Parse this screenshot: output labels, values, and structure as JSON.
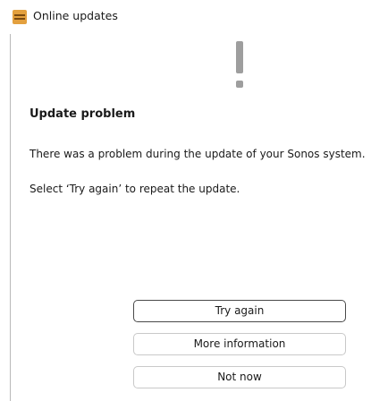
{
  "window": {
    "title": "Online updates",
    "app_icon": "sonos-app-icon"
  },
  "dialog": {
    "icon": "exclamation-icon",
    "heading": "Update problem",
    "message_line1": "There was a problem during the update of your Sonos system.",
    "message_line2": "Select ‘Try again’ to repeat the update."
  },
  "buttons": {
    "try_again": "Try again",
    "more_information": "More information",
    "not_now": "Not now"
  },
  "colors": {
    "icon_gray": "#9e9e9e",
    "app_icon_orange": "#e3a03e"
  }
}
